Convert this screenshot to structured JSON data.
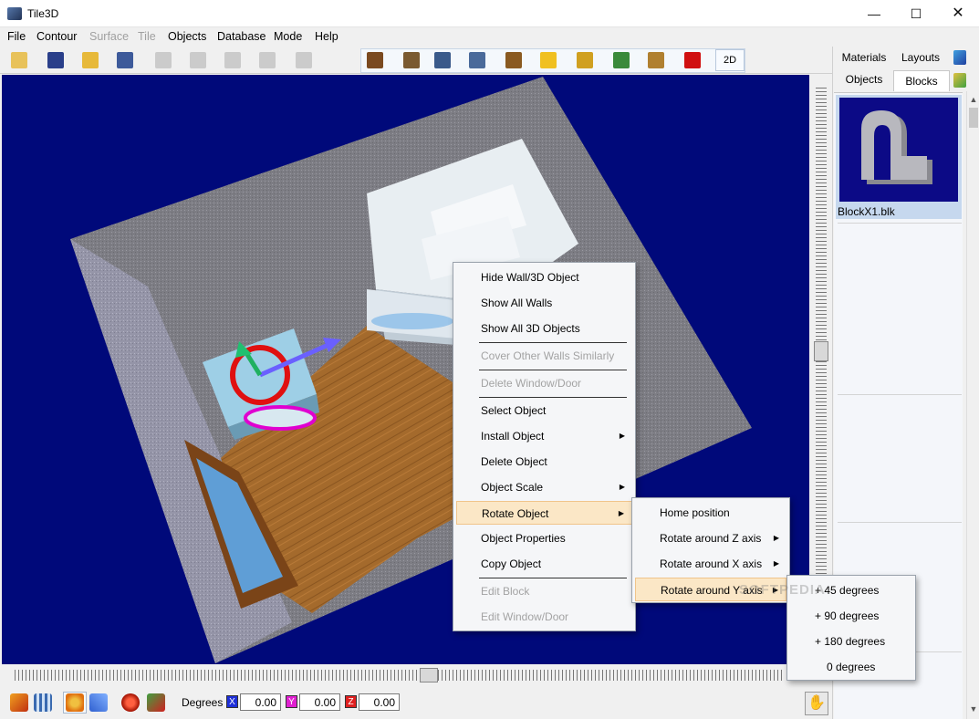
{
  "window": {
    "title": "Tile3D"
  },
  "menubar": [
    {
      "label": "File",
      "disabled": false
    },
    {
      "label": "Contour",
      "disabled": false
    },
    {
      "label": "Surface",
      "disabled": true
    },
    {
      "label": "Tile",
      "disabled": true
    },
    {
      "label": "Objects",
      "disabled": false
    },
    {
      "label": "Database",
      "disabled": false
    },
    {
      "label": "Mode",
      "disabled": false
    },
    {
      "label": "Help",
      "disabled": false
    }
  ],
  "toolbar": {
    "buttons": [
      {
        "icon": "new-document-icon",
        "color": "#e8c25a",
        "disabled": false
      },
      {
        "icon": "info-icon",
        "color": "#2a3f8a",
        "disabled": false
      },
      {
        "icon": "open-folder-icon",
        "color": "#e7b93a",
        "disabled": false
      },
      {
        "icon": "save-disk-icon",
        "color": "#3d5a9a",
        "disabled": false
      },
      {
        "icon": "grid-icon",
        "color": "#888888",
        "disabled": true
      },
      {
        "icon": "image-icon",
        "color": "#888888",
        "disabled": true
      },
      {
        "icon": "paint-icon",
        "color": "#888888",
        "disabled": true
      },
      {
        "icon": "cross-box-icon",
        "color": "#888888",
        "disabled": true
      },
      {
        "icon": "tag-icon",
        "color": "#888888",
        "disabled": true
      },
      {
        "icon": "import-arrow-icon",
        "color": "#7a4a20",
        "disabled": false
      },
      {
        "icon": "box-icon",
        "color": "#7a5a30",
        "disabled": false
      },
      {
        "icon": "cabinet-icon",
        "color": "#3a5a8a",
        "disabled": false
      },
      {
        "icon": "clipboard-icon",
        "color": "#4a6a9a",
        "disabled": false
      },
      {
        "icon": "door-icon",
        "color": "#8a5a20",
        "disabled": false
      },
      {
        "icon": "light-bulb-icon",
        "color": "#f0c020",
        "disabled": false
      },
      {
        "icon": "pen-light-icon",
        "color": "#d0a020",
        "disabled": false
      },
      {
        "icon": "checklist-icon",
        "color": "#3a8a3a",
        "disabled": false
      },
      {
        "icon": "tools-icon",
        "color": "#b08030",
        "disabled": false
      },
      {
        "icon": "delete-x-icon",
        "color": "#d01010",
        "disabled": false
      }
    ],
    "mode_label": "2D"
  },
  "right_panel": {
    "tabs_top": [
      "Materials",
      "Layouts"
    ],
    "tabs_bottom": [
      "Objects",
      "Blocks"
    ],
    "active_tab": "Blocks",
    "blocks": [
      {
        "name": "BlockX1.blk"
      }
    ]
  },
  "bottombar": {
    "degrees_label": "Degrees",
    "axes": [
      {
        "axis": "X",
        "color": "#1e2fd8",
        "value": "0.00"
      },
      {
        "axis": "Y",
        "color": "#e020d0",
        "value": "0.00"
      },
      {
        "axis": "Z",
        "color": "#e02020",
        "value": "0.00"
      }
    ]
  },
  "context_menu": {
    "items": [
      {
        "label": "Hide Wall/3D Object",
        "disabled": false,
        "submenu": false
      },
      {
        "label": "Show All Walls",
        "disabled": false,
        "submenu": false
      },
      {
        "label": "Show All 3D Objects",
        "disabled": false,
        "submenu": false
      },
      {
        "label": "Cover Other Walls Similarly",
        "disabled": true,
        "submenu": false
      },
      {
        "label": "Delete Window/Door",
        "disabled": true,
        "submenu": false
      },
      {
        "label": "Select Object",
        "disabled": false,
        "submenu": false
      },
      {
        "label": "Install Object",
        "disabled": false,
        "submenu": true
      },
      {
        "label": "Delete Object",
        "disabled": false,
        "submenu": false
      },
      {
        "label": "Object Scale",
        "disabled": false,
        "submenu": true
      },
      {
        "label": "Rotate Object",
        "disabled": false,
        "submenu": true,
        "highlighted": true
      },
      {
        "label": "Object Properties",
        "disabled": false,
        "submenu": false
      },
      {
        "label": "Copy Object",
        "disabled": false,
        "submenu": false
      },
      {
        "label": "Edit Block",
        "disabled": true,
        "submenu": false
      },
      {
        "label": "Edit Window/Door",
        "disabled": true,
        "submenu": false
      }
    ]
  },
  "rotate_submenu": {
    "items": [
      {
        "label": "Home position",
        "submenu": false
      },
      {
        "label": "Rotate around Z axis",
        "submenu": true
      },
      {
        "label": "Rotate around X axis",
        "submenu": true
      },
      {
        "label": "Rotate around Y axis",
        "submenu": true,
        "highlighted": true
      }
    ]
  },
  "degrees_submenu": {
    "items": [
      {
        "label": "+ 45 degrees"
      },
      {
        "label": "+ 90 degrees"
      },
      {
        "label": "+ 180 degrees"
      },
      {
        "label": "0 degrees"
      }
    ]
  },
  "watermark": "SOFTPEDIA"
}
